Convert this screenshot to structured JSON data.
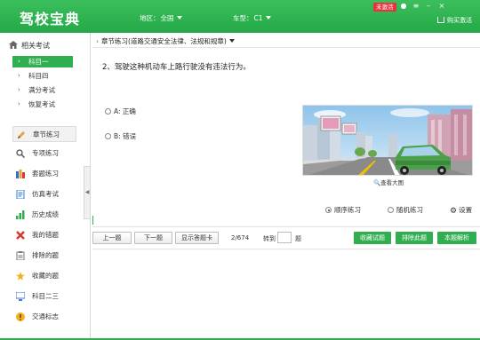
{
  "app": {
    "title": "驾校宝典",
    "region_label": "地区：",
    "region_value": "全国",
    "cartype_label": "车型：",
    "cartype_value": "C1",
    "login_badge": "未激活",
    "activate_label": "购买激活"
  },
  "sidebar": {
    "header": "相关考试",
    "subitems": [
      {
        "label": "科目一",
        "active": true
      },
      {
        "label": "科目四",
        "active": false
      },
      {
        "label": "满分考试",
        "active": false
      },
      {
        "label": "恢复考试",
        "active": false
      }
    ],
    "nav": [
      {
        "label": "章节练习",
        "icon": "pencil-icon",
        "active": true
      },
      {
        "label": "专项练习",
        "icon": "magnifier-icon",
        "active": false
      },
      {
        "label": "套题练习",
        "icon": "books-icon",
        "active": false
      },
      {
        "label": "仿真考试",
        "icon": "exam-sheet-icon",
        "active": false
      },
      {
        "label": "历史成绩",
        "icon": "bar-chart-icon",
        "active": false
      },
      {
        "label": "我的错题",
        "icon": "cross-icon",
        "active": false
      },
      {
        "label": "排除的题",
        "icon": "clipboard-icon",
        "active": false
      },
      {
        "label": "收藏的题",
        "icon": "star-icon",
        "active": false
      },
      {
        "label": "科目二三",
        "icon": "monitor-icon",
        "active": false
      },
      {
        "label": "交通标志",
        "icon": "warning-icon",
        "active": false
      }
    ]
  },
  "breadcrumb": {
    "label": "章节练习(道路交通安全法律、法规和规章)"
  },
  "question": {
    "text": "2、驾驶这种机动车上路行驶没有违法行为。",
    "options": [
      {
        "label": "A: 正确"
      },
      {
        "label": "B: 错误"
      }
    ],
    "zoom_label": "查看大图"
  },
  "modes": {
    "sequential": "顺序练习",
    "random": "随机练习",
    "selected": "sequential",
    "settings": "设置"
  },
  "toolbar": {
    "prev": "上一题",
    "next": "下一题",
    "answer_card": "显示答题卡",
    "progress": "2/674",
    "jump_label": "转到",
    "jump_value": "",
    "jump_unit": "题",
    "favorite": "收藏试题",
    "exclude": "排除此题",
    "explain": "本题解析"
  },
  "colors": {
    "brand_green": "#2faf4f",
    "badge_red": "#e8323c"
  }
}
